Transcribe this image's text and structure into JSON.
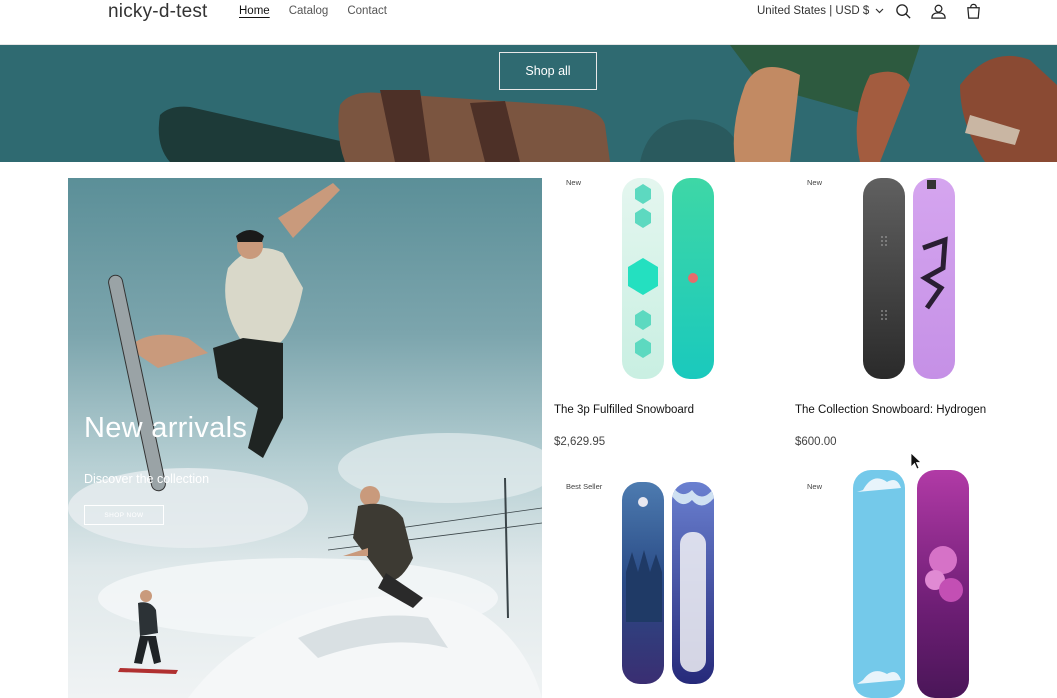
{
  "header": {
    "logo": "nicky-d-test",
    "nav": [
      {
        "label": "Home",
        "active": true
      },
      {
        "label": "Catalog",
        "active": false
      },
      {
        "label": "Contact",
        "active": false
      }
    ],
    "country": "United States | USD $",
    "icons": [
      "search-icon",
      "account-icon",
      "cart-icon"
    ]
  },
  "hero": {
    "button_label": "Shop all"
  },
  "promo": {
    "title": "New arrivals",
    "subtitle": "Discover the collection",
    "button_label": "SHOP NOW"
  },
  "products": [
    {
      "badge": "New",
      "title": "The 3p Fulfilled Snowboard",
      "price": "$2,629.95"
    },
    {
      "badge": "New",
      "title": "The Collection Snowboard: Hydrogen",
      "price": "$600.00"
    },
    {
      "badge": "Best Seller",
      "title": "",
      "price": ""
    },
    {
      "badge": "New",
      "title": "",
      "price": ""
    }
  ],
  "colors": {
    "hero_bg": "#2f6b72",
    "accent_text": "#121212"
  }
}
